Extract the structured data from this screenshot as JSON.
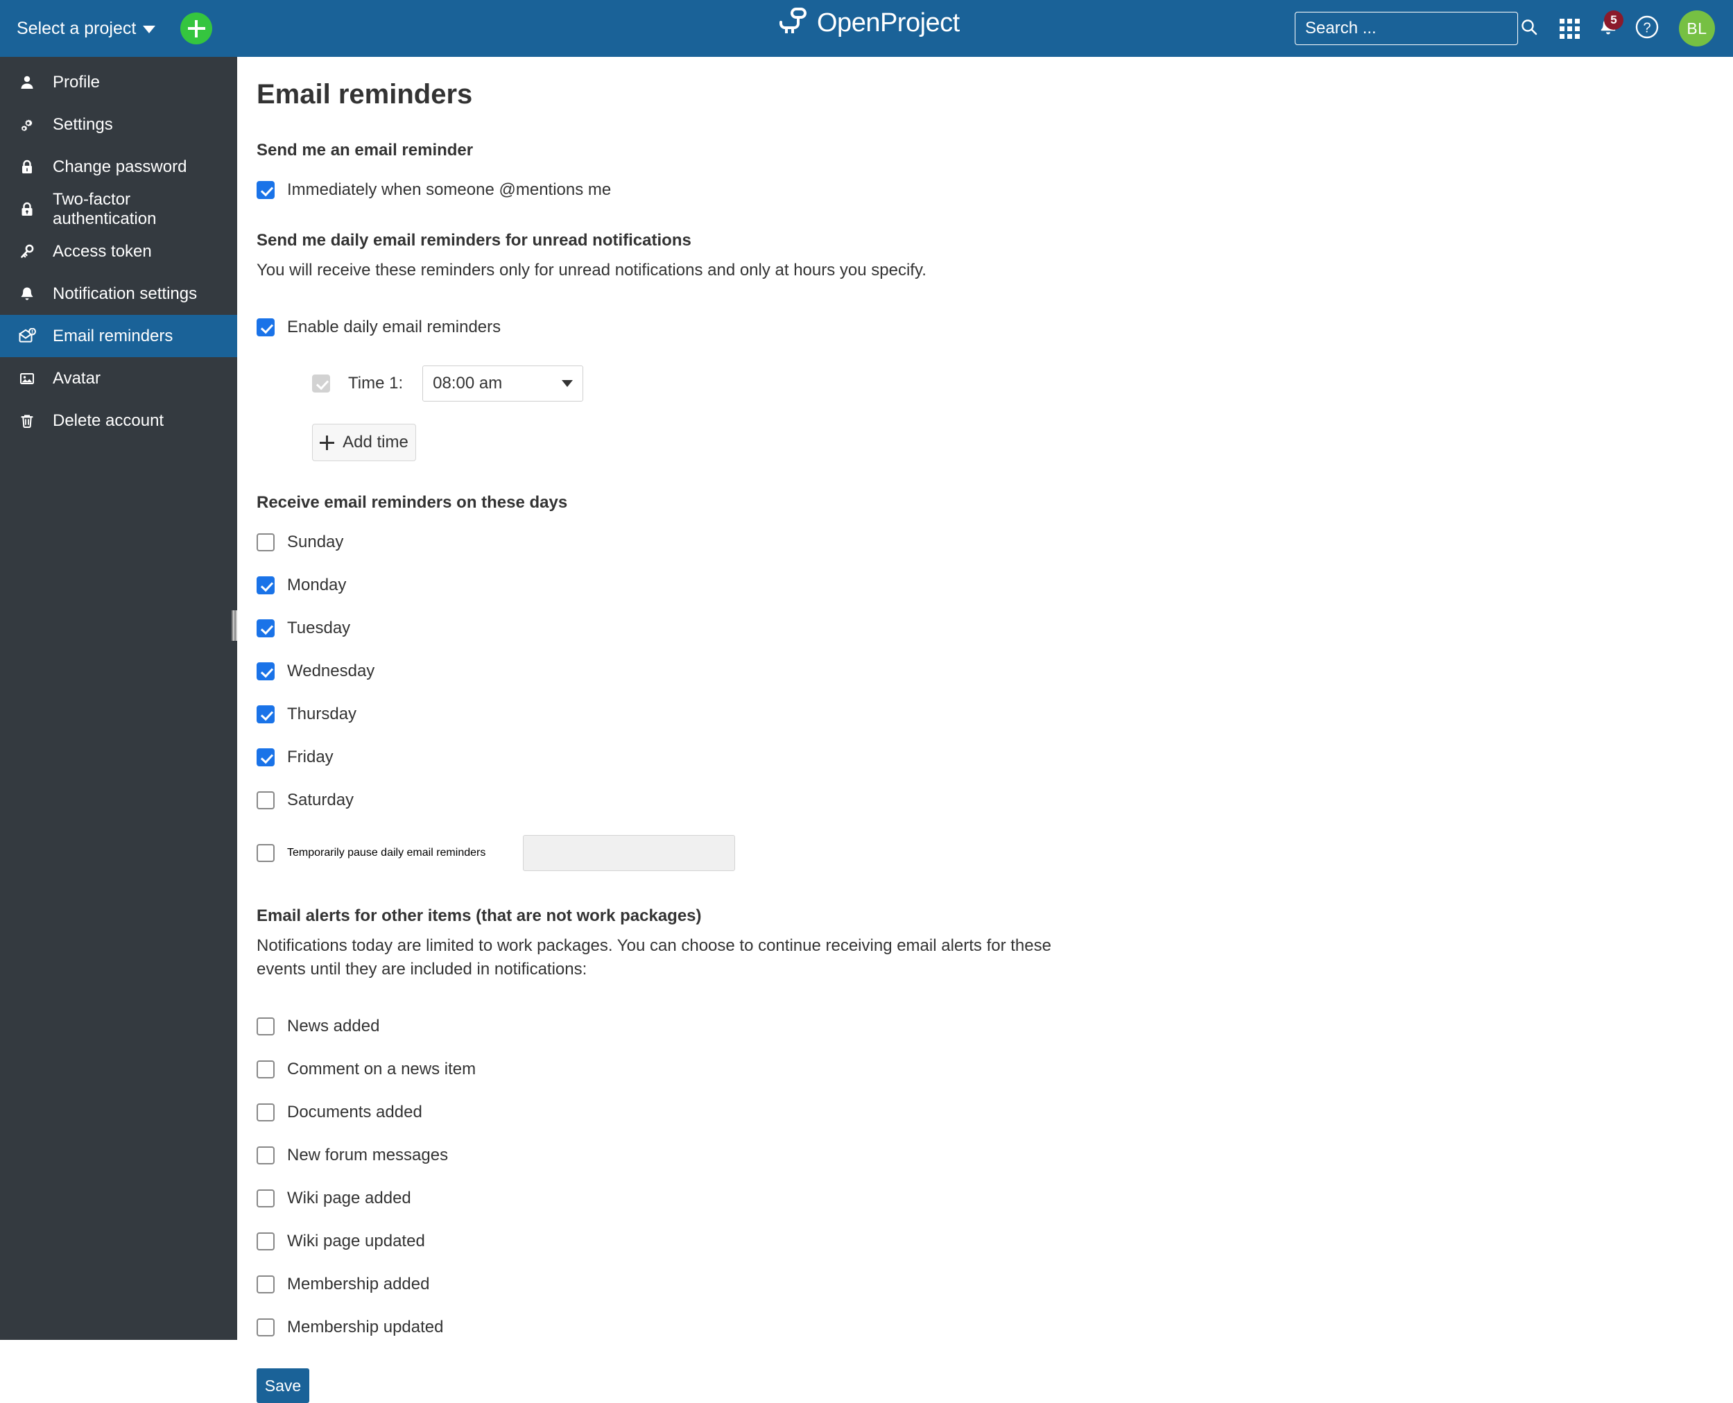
{
  "header": {
    "project_select_label": "Select a project",
    "add_button_icon": "plus-icon",
    "logo_text": "OpenProject",
    "search": {
      "placeholder": "Search ...",
      "value": "",
      "icon": "search-icon"
    },
    "modules_icon": "grid-icon",
    "notifications": {
      "icon": "bell-icon",
      "badge_count": "5"
    },
    "help_icon": "question-mark-icon",
    "avatar_initials": "BL"
  },
  "sidebar": {
    "items": [
      {
        "label": "Profile",
        "icon": "user-icon",
        "active": false
      },
      {
        "label": "Settings",
        "icon": "gears-icon",
        "active": false
      },
      {
        "label": "Change password",
        "icon": "lock-icon",
        "active": false
      },
      {
        "label": "Two-factor authentication",
        "icon": "lock-shield-icon",
        "active": false
      },
      {
        "label": "Access token",
        "icon": "key-icon",
        "active": false
      },
      {
        "label": "Notification settings",
        "icon": "bell-icon",
        "active": false
      },
      {
        "label": "Email reminders",
        "icon": "envelope-alert-icon",
        "active": true
      },
      {
        "label": "Avatar",
        "icon": "image-icon",
        "active": false
      },
      {
        "label": "Delete account",
        "icon": "trash-icon",
        "active": false
      }
    ]
  },
  "main": {
    "page_title": "Email reminders",
    "section_mention": {
      "heading": "Send me an email reminder",
      "option_label": "Immediately when someone @mentions me",
      "checked": true
    },
    "section_daily": {
      "heading": "Send me daily email reminders for unread notifications",
      "description": "You will receive these reminders only for unread notifications and only at hours you specify.",
      "enable_label": "Enable daily email reminders",
      "enable_checked": true,
      "time_rows": [
        {
          "label": "Time 1:",
          "value": "08:00 am",
          "checked": true,
          "disabled": true
        }
      ],
      "add_time_label": "Add time"
    },
    "section_days": {
      "heading": "Receive email reminders on these days",
      "days": [
        {
          "label": "Sunday",
          "checked": false
        },
        {
          "label": "Monday",
          "checked": true
        },
        {
          "label": "Tuesday",
          "checked": true
        },
        {
          "label": "Wednesday",
          "checked": true
        },
        {
          "label": "Thursday",
          "checked": true
        },
        {
          "label": "Friday",
          "checked": true
        },
        {
          "label": "Saturday",
          "checked": false
        }
      ],
      "pause_label": "Temporarily pause daily email reminders",
      "pause_checked": false,
      "pause_input_value": "",
      "pause_input_placeholder": ""
    },
    "section_alerts": {
      "heading": "Email alerts for other items (that are not work packages)",
      "description": "Notifications today are limited to work packages. You can choose to continue receiving email alerts for these events until they are included in notifications:",
      "items": [
        {
          "label": "News added",
          "checked": false
        },
        {
          "label": "Comment on a news item",
          "checked": false
        },
        {
          "label": "Documents added",
          "checked": false
        },
        {
          "label": "New forum messages",
          "checked": false
        },
        {
          "label": "Wiki page added",
          "checked": false
        },
        {
          "label": "Wiki page updated",
          "checked": false
        },
        {
          "label": "Membership added",
          "checked": false
        },
        {
          "label": "Membership updated",
          "checked": false
        }
      ]
    },
    "save_label": "Save"
  },
  "colors": {
    "header_blue": "#1a6298",
    "sidebar_dark": "#343a40",
    "accent_green": "#35c53f",
    "avatar_green": "#76c043",
    "badge_red": "#8b1a2b",
    "checkbox_blue": "#1a73e8"
  }
}
